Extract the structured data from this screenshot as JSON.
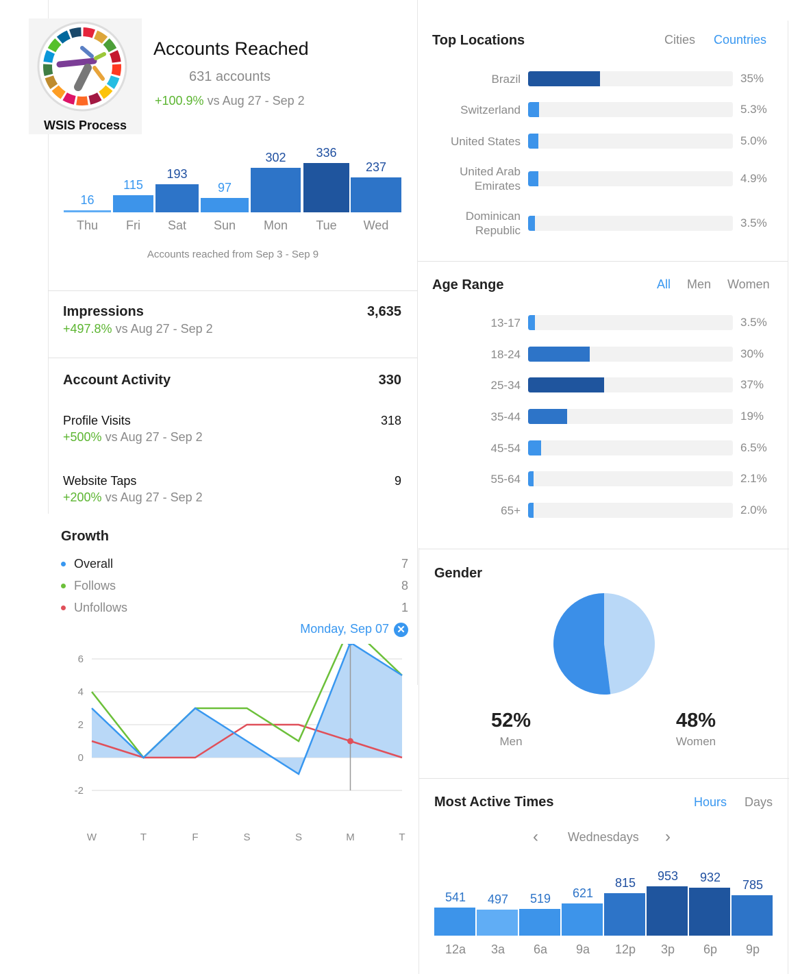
{
  "logo": {
    "name": "WSIS Process"
  },
  "accounts_reached": {
    "title": "Accounts Reached",
    "count": "631 accounts",
    "change": "+100.9%",
    "compare": " vs Aug 27 - Sep 2",
    "caption": "Accounts reached from Sep 3 - Sep 9"
  },
  "chart_data": [
    {
      "type": "bar",
      "categories": [
        "Thu",
        "Fri",
        "Sat",
        "Sun",
        "Mon",
        "Tue",
        "Wed"
      ],
      "values": [
        16,
        115,
        193,
        97,
        302,
        336,
        237
      ],
      "xlabel": "Accounts reached from Sep 3 - Sep 9"
    },
    {
      "type": "line",
      "x": [
        "W",
        "T",
        "F",
        "S",
        "S",
        "M",
        "T"
      ],
      "ylim": [
        -2,
        8
      ],
      "yticks": [
        8,
        6,
        4,
        2,
        0,
        -2
      ],
      "grid": true,
      "series": [
        {
          "name": "Overall",
          "values": [
            3,
            0,
            3,
            1,
            -1,
            7,
            5
          ],
          "color": "#3897f0"
        },
        {
          "name": "Follows",
          "values": [
            4,
            0,
            3,
            3,
            1,
            8,
            5
          ],
          "color": "#6cc03a"
        },
        {
          "name": "Unfollows",
          "values": [
            1,
            0,
            0,
            2,
            2,
            1,
            0
          ],
          "color": "#e0505a"
        }
      ],
      "selected_index": 5
    },
    {
      "type": "bar",
      "categories": [
        "12a",
        "3a",
        "6a",
        "9a",
        "12p",
        "3p",
        "6p",
        "9p"
      ],
      "values": [
        541,
        497,
        519,
        621,
        815,
        953,
        932,
        785
      ]
    },
    {
      "type": "pie",
      "categories": [
        "Men",
        "Women"
      ],
      "values": [
        52,
        48
      ],
      "colors": [
        "#3b8fe8",
        "#b9d8f7"
      ]
    }
  ],
  "impressions": {
    "title": "Impressions",
    "value": "3,635",
    "change": "+497.8%",
    "compare": " vs Aug 27 - Sep 2"
  },
  "activity": {
    "title": "Account Activity",
    "value": "330",
    "items": [
      {
        "label": "Profile Visits",
        "value": "318",
        "change": "+500%",
        "compare": " vs Aug 27 - Sep 2"
      },
      {
        "label": "Website Taps",
        "value": "9",
        "change": "+200%",
        "compare": " vs Aug 27 - Sep 2"
      }
    ]
  },
  "growth": {
    "title": "Growth",
    "legend": [
      {
        "label": "Overall",
        "value": "7",
        "color": "#3897f0"
      },
      {
        "label": "Follows",
        "value": "8",
        "color": "#6cc03a"
      },
      {
        "label": "Unfollows",
        "value": "1",
        "color": "#e0505a"
      }
    ],
    "selected": "Monday, Sep 07"
  },
  "locations": {
    "title": "Top Locations",
    "tabs": [
      "Cities",
      "Countries"
    ],
    "active_tab": "Countries",
    "rows": [
      {
        "label": "Brazil",
        "pct": "35%",
        "value": 35
      },
      {
        "label": "Switzerland",
        "pct": "5.3%",
        "value": 5.3
      },
      {
        "label": "United States",
        "pct": "5.0%",
        "value": 5.0
      },
      {
        "label": "United Arab Emirates",
        "pct": "4.9%",
        "value": 4.9
      },
      {
        "label": "Dominican Republic",
        "pct": "3.5%",
        "value": 3.5
      }
    ]
  },
  "age": {
    "title": "Age Range",
    "tabs": [
      "All",
      "Men",
      "Women"
    ],
    "active_tab": "All",
    "rows": [
      {
        "label": "13-17",
        "pct": "3.5%",
        "value": 3.5
      },
      {
        "label": "18-24",
        "pct": "30%",
        "value": 30
      },
      {
        "label": "25-34",
        "pct": "37%",
        "value": 37
      },
      {
        "label": "35-44",
        "pct": "19%",
        "value": 19
      },
      {
        "label": "45-54",
        "pct": "6.5%",
        "value": 6.5
      },
      {
        "label": "55-64",
        "pct": "2.1%",
        "value": 2.1
      },
      {
        "label": "65+",
        "pct": "2.0%",
        "value": 2.0
      }
    ]
  },
  "gender": {
    "title": "Gender",
    "men_pct": "52%",
    "men": "Men",
    "women_pct": "48%",
    "women": "Women"
  },
  "active_times": {
    "title": "Most Active Times",
    "tabs": [
      "Hours",
      "Days"
    ],
    "active_tab": "Hours",
    "day": "Wednesdays"
  },
  "colors": {
    "light": "#3d94ea",
    "medium": "#2d74c8",
    "dark": "#1f559e",
    "lightest": "#60adf5",
    "green": "#5cb531",
    "accent": "#3897f0"
  }
}
